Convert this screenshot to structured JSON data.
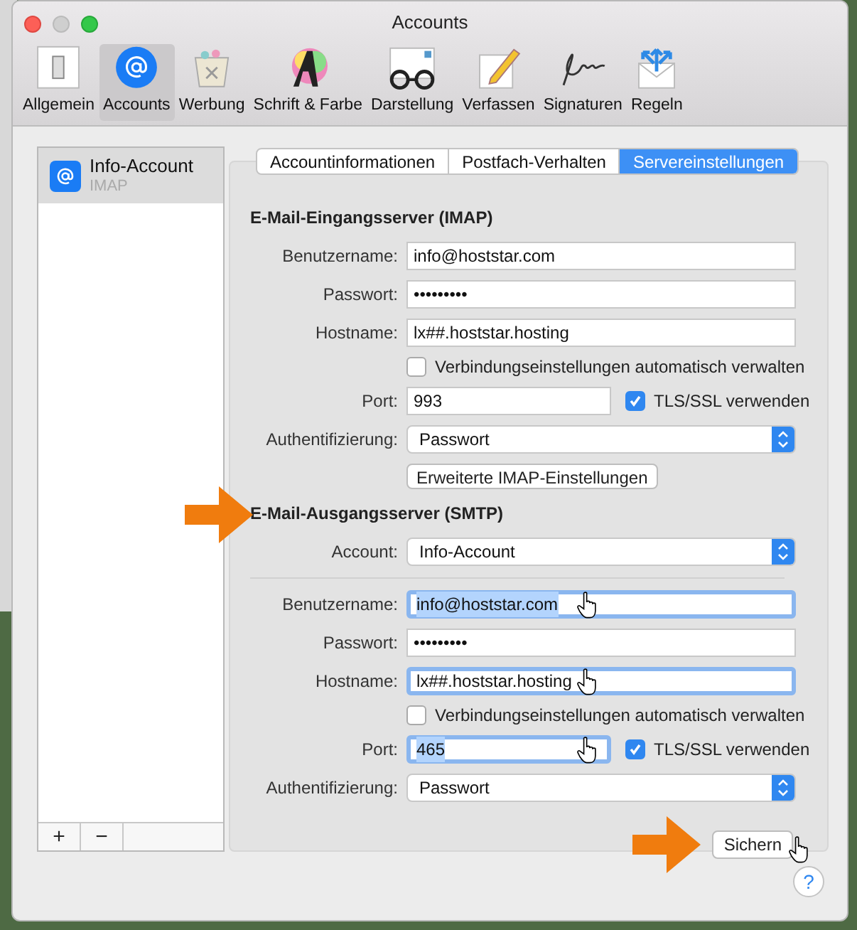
{
  "window": {
    "title": "Accounts"
  },
  "toolbar": [
    {
      "label": "Allgemein",
      "kind": "general",
      "selected": false
    },
    {
      "label": "Accounts",
      "kind": "accounts",
      "selected": true
    },
    {
      "label": "Werbung",
      "kind": "junk",
      "selected": false
    },
    {
      "label": "Schrift & Farbe",
      "kind": "fonts",
      "selected": false
    },
    {
      "label": "Darstellung",
      "kind": "viewing",
      "selected": false
    },
    {
      "label": "Verfassen",
      "kind": "composing",
      "selected": false
    },
    {
      "label": "Signaturen",
      "kind": "signatures",
      "selected": false
    },
    {
      "label": "Regeln",
      "kind": "rules",
      "selected": false
    }
  ],
  "accounts": [
    {
      "name": "Info-Account",
      "type": "IMAP",
      "selected": true
    }
  ],
  "list_buttons": [
    "+",
    "−"
  ],
  "tabs": [
    {
      "label": "Accountinformationen",
      "selected": false
    },
    {
      "label": "Postfach-Verhalten",
      "selected": false
    },
    {
      "label": "Servereinstellungen",
      "selected": true
    }
  ],
  "sections": [
    {
      "heading": "E-Mail-Eingangsserver (IMAP)",
      "arrow": false,
      "rows": [
        {
          "kind": "text",
          "label": "Benutzername:",
          "value": "info@hoststar.com",
          "focused": false,
          "highlighted": false,
          "pointer": false
        },
        {
          "kind": "text",
          "label": "Passwort:",
          "value": "•••••••••",
          "focused": false,
          "highlighted": false,
          "pointer": false
        },
        {
          "kind": "text",
          "label": "Hostname:",
          "value": "lx##.hoststar.hosting",
          "focused": false,
          "highlighted": false,
          "pointer": false
        },
        {
          "kind": "checkbox",
          "text": "Verbindungseinstellungen automatisch verwalten",
          "checked": false
        },
        {
          "kind": "port",
          "label": "Port:",
          "value": "993",
          "focused": false,
          "highlighted": false,
          "pointer": false,
          "tls": {
            "text": "TLS/SSL verwenden",
            "checked": true
          }
        },
        {
          "kind": "select",
          "label": "Authentifizierung:",
          "value": "Passwort"
        },
        {
          "kind": "button",
          "text": "Erweiterte IMAP-Einstellungen"
        }
      ]
    },
    {
      "heading": "E-Mail-Ausgangsserver (SMTP)",
      "arrow": true,
      "rows": [
        {
          "kind": "select",
          "label": "Account:",
          "value": "Info-Account"
        },
        {
          "kind": "divider"
        },
        {
          "kind": "text",
          "label": "Benutzername:",
          "value": "info@hoststar.com",
          "focused": true,
          "highlighted": true,
          "pointer": true
        },
        {
          "kind": "text",
          "label": "Passwort:",
          "value": "•••••••••",
          "focused": false,
          "highlighted": false,
          "pointer": false
        },
        {
          "kind": "text",
          "label": "Hostname:",
          "value": "lx##.hoststar.hosting",
          "focused": true,
          "highlighted": false,
          "pointer": true
        },
        {
          "kind": "checkbox",
          "text": "Verbindungseinstellungen automatisch verwalten",
          "checked": false
        },
        {
          "kind": "port",
          "label": "Port:",
          "value": "465",
          "focused": true,
          "highlighted": true,
          "pointer": true,
          "tls": {
            "text": "TLS/SSL verwenden",
            "checked": true
          }
        },
        {
          "kind": "select",
          "label": "Authentifizierung:",
          "value": "Passwort"
        }
      ]
    }
  ],
  "save_button": "Sichern",
  "help_button": "?"
}
